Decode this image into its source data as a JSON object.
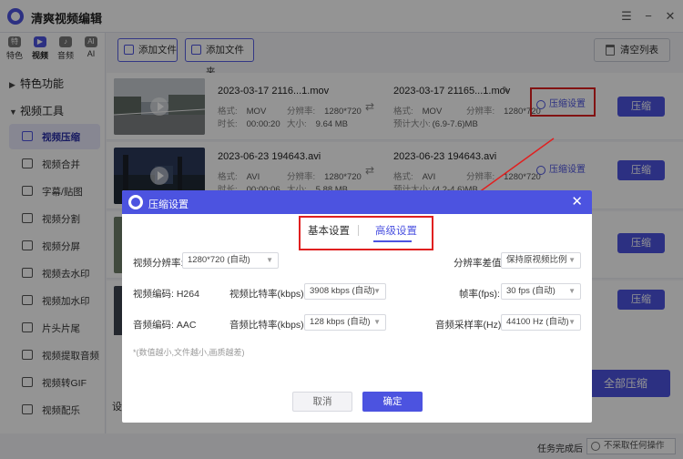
{
  "app": {
    "title": "清爽视频编辑"
  },
  "window": {
    "menu_icon": "☰",
    "minimize_icon": "−",
    "close_icon": "✕"
  },
  "topnav": [
    {
      "label": "特色",
      "icon": "特"
    },
    {
      "label": "视频",
      "icon": "▶"
    },
    {
      "label": "音频",
      "icon": "♪"
    },
    {
      "label": "AI",
      "icon": "AI"
    }
  ],
  "sidebar": {
    "section1": "特色功能",
    "section2": "视频工具",
    "items": [
      {
        "label": "视频压缩"
      },
      {
        "label": "视频合并"
      },
      {
        "label": "字幕/贴图"
      },
      {
        "label": "视频分割"
      },
      {
        "label": "视频分屏"
      },
      {
        "label": "视频去水印"
      },
      {
        "label": "视频加水印"
      },
      {
        "label": "片头片尾"
      },
      {
        "label": "视频提取音频"
      },
      {
        "label": "视频转GIF"
      },
      {
        "label": "视频配乐"
      }
    ]
  },
  "toolbar": {
    "add_file": "添加文件",
    "add_folder": "添加文件夹",
    "clear_list": "清空列表"
  },
  "files": [
    {
      "src_name": "2023-03-17 2116...1.mov",
      "src_format_label": "格式:",
      "src_format": "MOV",
      "src_res_label": "分辨率:",
      "src_res": "1280*720",
      "src_dur_label": "时长:",
      "src_dur": "00:00:20",
      "src_size_label": "大小:",
      "src_size": "9.64 MB",
      "out_name": "2023-03-17 21165...1.mov",
      "out_format_label": "格式:",
      "out_format": "MOV",
      "out_res_label": "分辨率:",
      "out_res": "1280*720",
      "out_est_label": "预计大小:",
      "out_est": "(6.9-7.6)MB",
      "settings_label": "压缩设置",
      "compress_label": "压缩"
    },
    {
      "src_name": "2023-06-23 194643.avi",
      "src_format_label": "格式:",
      "src_format": "AVI",
      "src_res_label": "分辨率:",
      "src_res": "1280*720",
      "src_dur_label": "时长:",
      "src_dur": "00:00:06",
      "src_size_label": "大小:",
      "src_size": "5.88 MB",
      "out_name": "2023-06-23 194643.avi",
      "out_format_label": "格式:",
      "out_format": "AVI",
      "out_res_label": "分辨率:",
      "out_res": "1280*720",
      "out_est_label": "预计大小:",
      "out_est": "(4.2-4.6)MB",
      "settings_label": "压缩设置",
      "compress_label": "压缩"
    },
    {
      "compress_label": "压缩"
    },
    {
      "compress_label": "压缩"
    }
  ],
  "bottom": {
    "partial1": "设",
    "partial2": "输",
    "compress_all": "全部压缩"
  },
  "status": {
    "label": "任务完成后",
    "option": "不采取任何操作"
  },
  "dialog": {
    "title": "压缩设置",
    "tab_basic": "基本设置",
    "tab_advanced": "高级设置",
    "resolution_label": "视频分辨率:",
    "resolution_value": "1280*720 (自动)",
    "res_diff_label": "分辨率差值:",
    "res_diff_value": "保持原视频比例",
    "vcodec_label": "视频编码:",
    "vcodec_value": "H264",
    "vbitrate_label": "视频比特率(kbps):",
    "vbitrate_value": "3908 kbps (自动)",
    "fps_label": "帧率(fps):",
    "fps_value": "30 fps (自动)",
    "acodec_label": "音频编码:",
    "acodec_value": "AAC",
    "abitrate_label": "音频比特率(kbps):",
    "abitrate_value": "128 kbps (自动)",
    "asample_label": "音频采样率(Hz):",
    "asample_value": "44100 Hz (自动)",
    "note": "*(数值越小,文件越小,画质越差)",
    "cancel": "取消",
    "ok": "确定",
    "close_icon": "✕"
  },
  "colors": {
    "accent": "#4c53e0",
    "highlight": "#e02020"
  }
}
